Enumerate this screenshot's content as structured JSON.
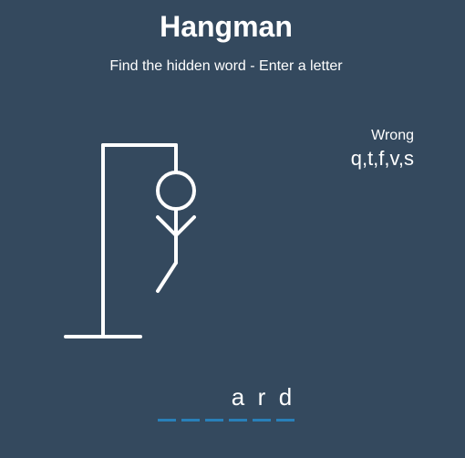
{
  "header": {
    "title": "Hangman",
    "subtitle": "Find the hidden word - Enter a letter"
  },
  "wrong": {
    "label": "Wrong",
    "letters": "q,t,f,v,s"
  },
  "word": {
    "slots": [
      "",
      "",
      "",
      "a",
      "r",
      "d"
    ]
  },
  "colors": {
    "background": "#34495e",
    "foreground": "#ffffff",
    "underline": "#2980b9"
  },
  "figure": {
    "parts_visible": [
      "gallows-base",
      "gallows-pole",
      "gallows-top",
      "rope",
      "head",
      "body",
      "left-arm",
      "right-arm",
      "left-leg"
    ],
    "icon": "hangman-figure-icon"
  }
}
